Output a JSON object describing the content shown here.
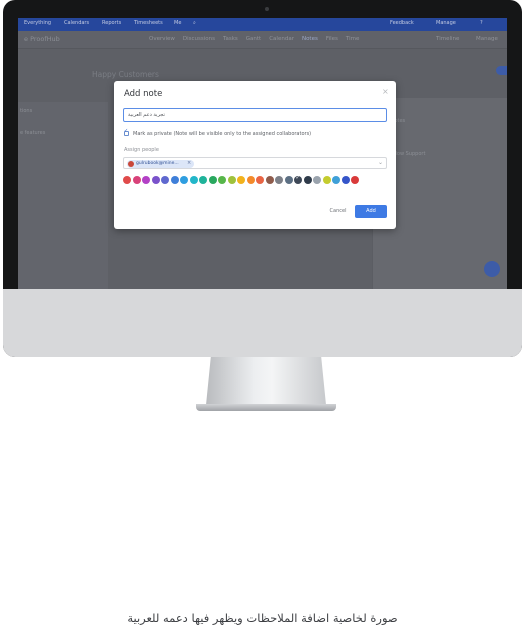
{
  "caption": "صورة لخاصية اضافة الملاحظات ويظهر فيها دعمه للعربية",
  "app": {
    "topbar": {
      "items": [
        "Everything",
        "Calendars",
        "Reports",
        "Timesheets",
        "Me"
      ],
      "right_items": [
        "Feedback",
        "Manage"
      ]
    },
    "brand": "e ProofHub",
    "tabs": [
      "Overview",
      "Discussions",
      "Tasks",
      "Gantt",
      "Calendar",
      "Notes",
      "Files",
      "Time"
    ],
    "active_tab": "Notes",
    "nav_right": [
      "Timeline",
      "Manage"
    ],
    "board_title": "Happy Customers",
    "left_texts": [
      "tions",
      "e features"
    ],
    "right_texts": [
      "Add notes",
      "WorkFlow Support"
    ]
  },
  "modal": {
    "title": "Add note",
    "close_icon": "close-icon",
    "note_value": "تجربة دعم العربية",
    "private_checked": true,
    "private_label": "Mark as private (Note will be visible only to the assigned collaborators)",
    "assign_label": "Assign people",
    "assignee": "gulrubook@mine...",
    "colors": [
      "#e04b4b",
      "#d8427a",
      "#b340c6",
      "#7a52cb",
      "#5f68cf",
      "#3f7fd9",
      "#2f9ee0",
      "#22b6c9",
      "#1fb39a",
      "#29a85f",
      "#57b64a",
      "#9fc23c",
      "#f2b21d",
      "#f38a2b",
      "#e96545",
      "#8f5c4c",
      "#7d8088",
      "#5c6f83",
      "#3e4857",
      "#2f3b4a",
      "#9aa3ad",
      "#c4cc2e",
      "#3fa0d8",
      "#3555c9",
      "#d93a3a"
    ],
    "selected_color": "#3e4857",
    "cancel_label": "Cancel",
    "add_label": "Add"
  }
}
